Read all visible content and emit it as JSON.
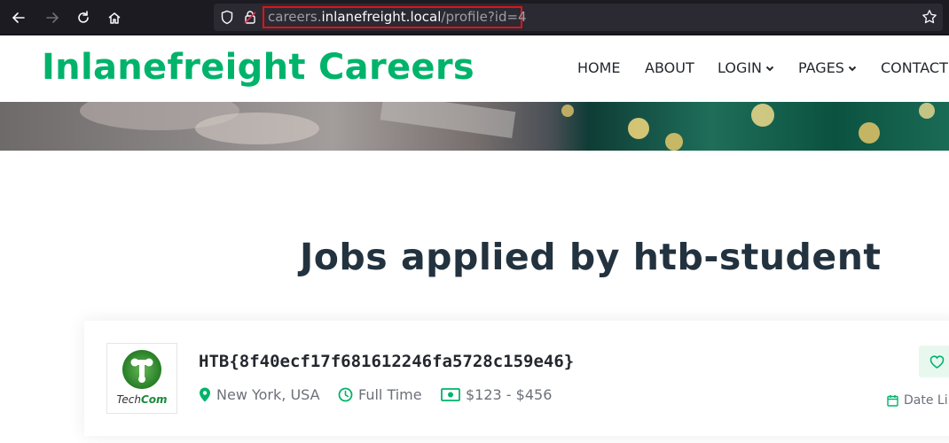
{
  "browser": {
    "url_scheme_part": "careers.",
    "url_host": "inlanefreight.local",
    "url_path": "/profile?id=4"
  },
  "site": {
    "brand": "Inlanefreight Careers",
    "nav": [
      {
        "label": "HOME"
      },
      {
        "label": "ABOUT"
      },
      {
        "label": "LOGIN"
      },
      {
        "label": "PAGES"
      },
      {
        "label": "CONTACT"
      }
    ]
  },
  "main": {
    "heading": "Jobs applied by htb-student",
    "job": {
      "company_logo_text_a": "Tech",
      "company_logo_text_b": "Com",
      "title": "HTB{8f40ecf17f681612246fa5728c159e46}",
      "location": "New York, USA",
      "type": "Full Time",
      "salary": "$123 - $456",
      "date_label": "Date Li"
    }
  },
  "colors": {
    "brand": "#00b36b",
    "highlight": "#e0121a"
  }
}
